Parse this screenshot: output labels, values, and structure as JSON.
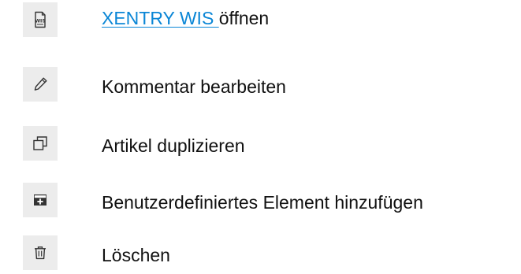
{
  "menu": {
    "items": [
      {
        "icon": "wis-document-icon",
        "icon_text": "WIS",
        "link_text": "XENTRY WIS ",
        "label": "öffnen"
      },
      {
        "icon": "pencil-icon",
        "label": "Kommentar bearbeiten"
      },
      {
        "icon": "duplicate-icon",
        "label": "Artikel duplizieren"
      },
      {
        "icon": "add-custom-element-icon",
        "label": "Benutzerdefiniertes Element hinzufügen"
      },
      {
        "icon": "trash-icon",
        "label": "Löschen"
      }
    ]
  },
  "colors": {
    "link": "#0a86d6",
    "text": "#111111",
    "icon": "#333333",
    "icon_background": "#ececec"
  }
}
